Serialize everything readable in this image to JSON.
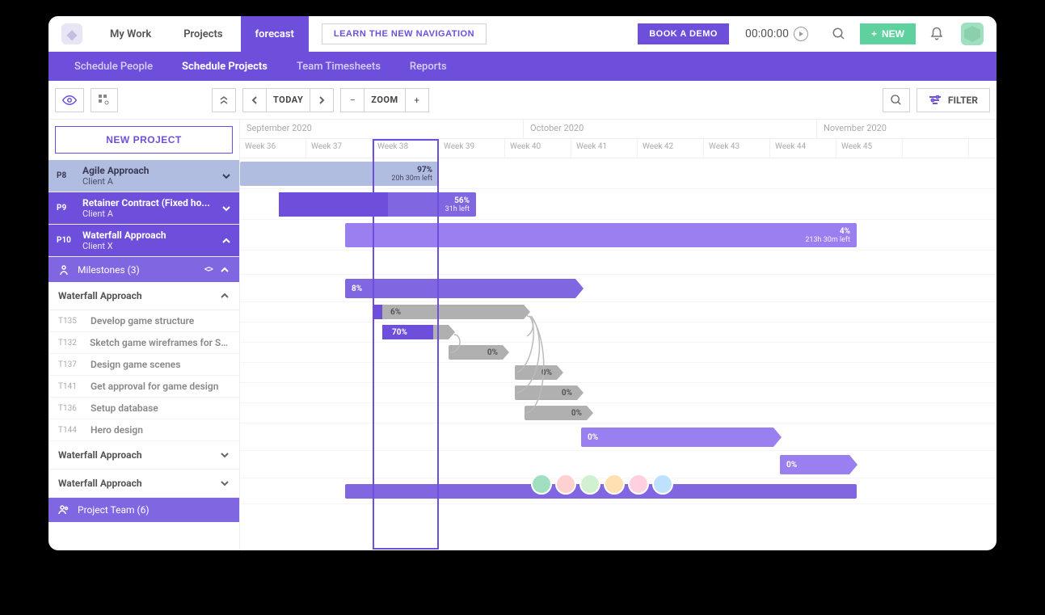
{
  "nav": {
    "items": [
      "My Work",
      "Projects",
      "forecast"
    ],
    "learn": "LEARN THE NEW NAVIGATION",
    "demo": "BOOK A DEMO",
    "timer": "00:00:00",
    "new": "NEW"
  },
  "subnav": {
    "items": [
      "Schedule People",
      "Schedule Projects",
      "Team Timesheets",
      "Reports"
    ]
  },
  "toolbar": {
    "today": "TODAY",
    "zoom": "ZOOM",
    "filter": "FILTER"
  },
  "sidebar": {
    "new_project": "NEW PROJECT",
    "projects": [
      {
        "id": "P8",
        "name": "Agile Approach",
        "client": "Client A"
      },
      {
        "id": "P9",
        "name": "Retainer Contract (Fixed ho...",
        "client": "Client A"
      },
      {
        "id": "P10",
        "name": "Waterfall Approach",
        "client": "Client X"
      }
    ],
    "milestones_label": "Milestones (3)",
    "phase": "Waterfall Approach",
    "tasks": [
      {
        "id": "T135",
        "name": "Develop game structure"
      },
      {
        "id": "T132",
        "name": "Sketch game wireframes for Sp..."
      },
      {
        "id": "T137",
        "name": "Design game scenes"
      },
      {
        "id": "T141",
        "name": "Get approval for game design"
      },
      {
        "id": "T136",
        "name": "Setup database"
      },
      {
        "id": "T144",
        "name": "Hero design"
      }
    ],
    "phase2": "Waterfall Approach",
    "phase3": "Waterfall Approach",
    "team": "Project Team (6)"
  },
  "timeline": {
    "months": [
      "September 2020",
      "October 2020",
      "November 2020"
    ],
    "weeks": [
      "Week 36",
      "Week 37",
      "Week 38",
      "Week 39",
      "Week 40",
      "Week 41",
      "Week 42",
      "Week 43",
      "Week 44",
      "Week 45"
    ],
    "bars": {
      "p8": {
        "pct": "97%",
        "left": "20h 30m left"
      },
      "p9": {
        "pct": "56%",
        "left": "31h left"
      },
      "p10": {
        "pct": "4%",
        "left": "213h 30m left"
      },
      "phase1": "8%",
      "t135": "6%",
      "t132": "70%",
      "t137": "0%",
      "t141": "0%",
      "t136": "0%",
      "t144": "0%",
      "phase2": "0%",
      "phase3": "0%"
    }
  }
}
